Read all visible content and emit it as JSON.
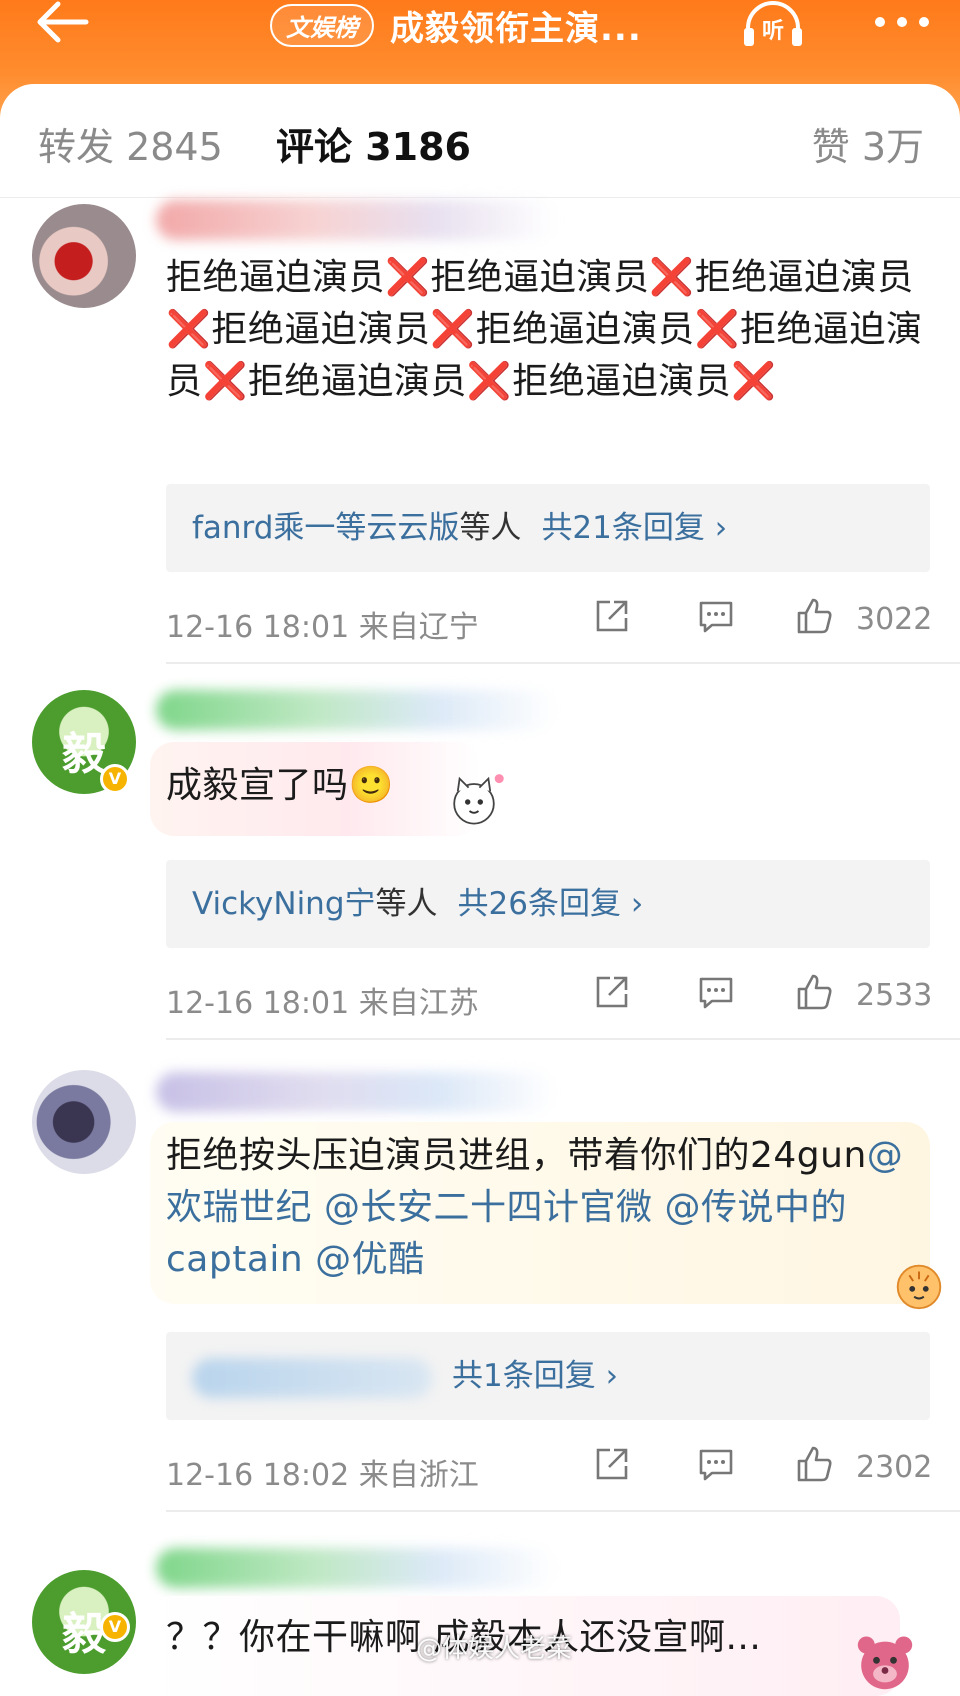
{
  "header": {
    "rank_badge": "文娱榜",
    "title": "成毅领衔主演...",
    "listen_label": "听",
    "accent_color": "#ff7a1a"
  },
  "tabs": [
    {
      "label": "转发 2845"
    },
    {
      "label": "评论 3186"
    },
    {
      "label": "赞 3万"
    }
  ],
  "comments": [
    {
      "text_segments": [
        "拒绝逼迫演员",
        "❌",
        "拒绝逼迫演员",
        "❌",
        "拒绝逼迫演员",
        "❌",
        "拒绝逼迫演员",
        "❌",
        "拒绝逼迫演员",
        "❌",
        "拒绝逼迫演员",
        "❌",
        "拒绝逼迫演员",
        "❌",
        "拒绝逼迫演员",
        "❌"
      ],
      "reply_names": "fanrd乘一等云云版",
      "reply_etc": "等人",
      "reply_total": "共21条回复 ›",
      "time": "12-16 18:01 来自辽宁",
      "likes": "3022"
    },
    {
      "text": "成毅宣了吗🙂",
      "reply_names": "VickyNing宁",
      "reply_etc": "等人",
      "reply_total": "共26条回复 ›",
      "time": "12-16 18:01 来自江苏",
      "likes": "2533"
    },
    {
      "text_plain": "拒绝按头压迫演员进组，带着你们的24gun",
      "mentions": [
        "@欢瑞世纪",
        "@长安二十四计官微",
        "@传说中的captain",
        "@优酷"
      ],
      "reply_total": "共1条回复 ›",
      "time": "12-16 18:02 来自浙江",
      "likes": "2302"
    },
    {
      "text": "？？你在干嘛啊 成毅本人还没宣啊..."
    }
  ],
  "watermark": "@体娱人老菜"
}
